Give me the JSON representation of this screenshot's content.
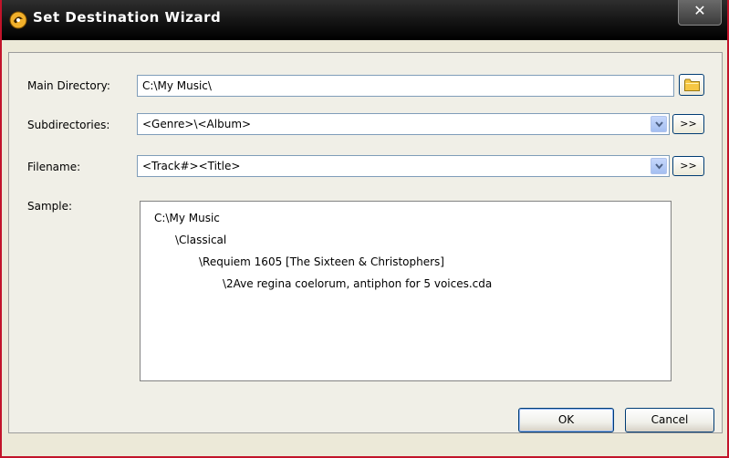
{
  "window": {
    "title": "Set Destination Wizard",
    "close_glyph": "✕"
  },
  "main_directory": {
    "label": "Main Directory:",
    "value": "C:\\My Music\\"
  },
  "subdirectories": {
    "label": "Subdirectories:",
    "value": "<Genre>\\<Album>",
    "more_label": ">>"
  },
  "filename": {
    "label": "Filename:",
    "value": "<Track#><Title>",
    "more_label": ">>"
  },
  "sample": {
    "label": "Sample:",
    "lines": [
      "C:\\My Music",
      "\\Classical",
      "\\Requiem 1605 [The Sixteen & Christophers]",
      "\\2Ave regina coelorum, antiphon for 5 voices.cda"
    ]
  },
  "buttons": {
    "ok": "OK",
    "cancel": "Cancel"
  },
  "icons": {
    "title": "app-logo-icon",
    "browse": "folder-icon",
    "dropdown": "chevron-down-icon"
  },
  "colors": {
    "window_border": "#c2142a",
    "titlebar": "#131313",
    "field_border": "#7f9db9",
    "folder_icon": "#f6c744"
  }
}
